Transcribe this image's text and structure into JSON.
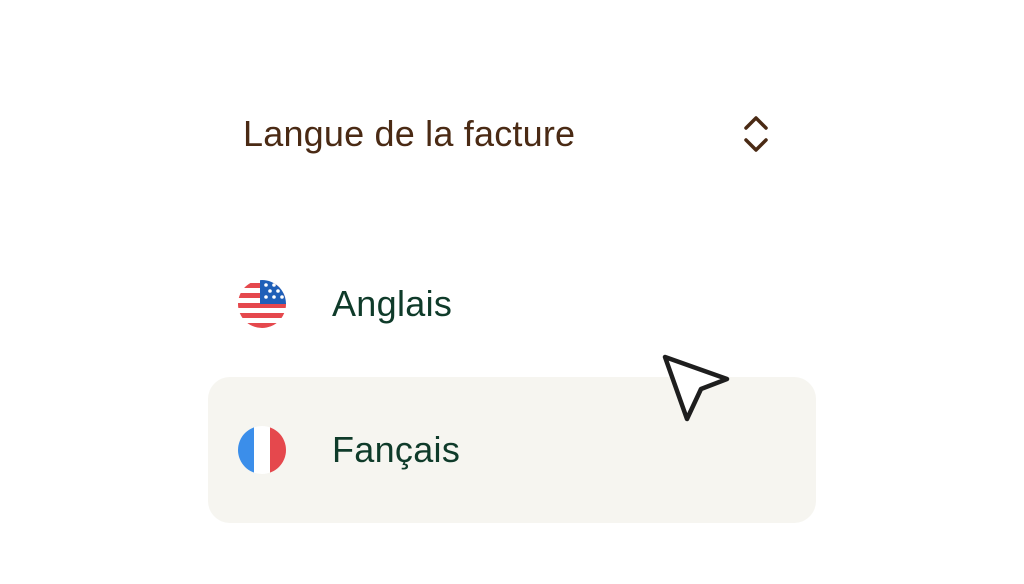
{
  "select": {
    "label": "Langue de la facture",
    "toggle_icon": "chevron-up-down-icon"
  },
  "options": [
    {
      "label": "Anglais",
      "flag_icon": "us-flag-icon",
      "highlighted": false
    },
    {
      "label": "Fançais",
      "flag_icon": "france-flag-icon",
      "highlighted": true
    }
  ],
  "colors": {
    "select_label": "#4a2a14",
    "option_label": "#0f3b2a",
    "highlight_bg": "#f6f5f0"
  },
  "cursor_icon": "pointer-arrow-icon"
}
